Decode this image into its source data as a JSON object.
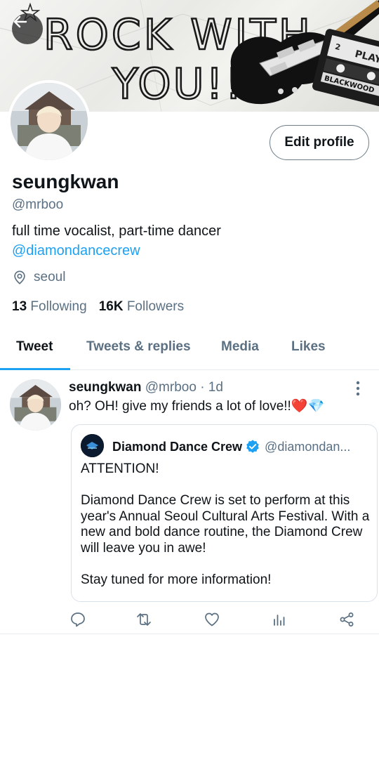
{
  "banner": {
    "headline_line1": "ROCK WITH",
    "headline_line2": "YOU!!",
    "cassette_label": "BLACKWOOD",
    "cassette_side": "2",
    "cassette_text": "PLAY"
  },
  "profile": {
    "display_name": "seungkwan",
    "handle": "@mrboo",
    "bio_text": "full time vocalist, part-time dancer",
    "bio_link": "@diamondancecrew",
    "location": "seoul",
    "following_count": "13",
    "following_label": "Following",
    "followers_count": "16K",
    "followers_label": "Followers",
    "edit_button": "Edit profile"
  },
  "tabs": [
    {
      "label": "Tweet",
      "active": true
    },
    {
      "label": "Tweets & replies",
      "active": false
    },
    {
      "label": "Media",
      "active": false
    },
    {
      "label": "Likes",
      "active": false
    }
  ],
  "tweet": {
    "author_name": "seungkwan",
    "author_handle": "@mrboo",
    "time": "· 1d",
    "text": "oh? OH! give my friends a lot of love!!❤️💎",
    "quote": {
      "author_name": "Diamond Dance Crew",
      "author_handle": "@diamondan...",
      "paragraphs": [
        "ATTENTION!",
        "Diamond Dance Crew is set to perform at this year's Annual Seoul Cultural Arts Festival. With a new and bold dance routine, the Diamond Crew will leave you in awe!",
        "Stay tuned for more information!"
      ]
    }
  },
  "icons": {
    "back": "arrow-left-icon",
    "location": "location-pin-icon",
    "more": "more-vertical-icon",
    "verified": "verified-badge-icon",
    "reply": "reply-icon",
    "retweet": "retweet-icon",
    "like": "heart-icon",
    "analytics": "analytics-icon",
    "share": "share-icon"
  },
  "colors": {
    "accent": "#1da1f2",
    "secondary_text": "#5b7083",
    "primary_text": "#0f1419",
    "like_heart": "#e8262b",
    "diamond": "#7fc8f0"
  }
}
